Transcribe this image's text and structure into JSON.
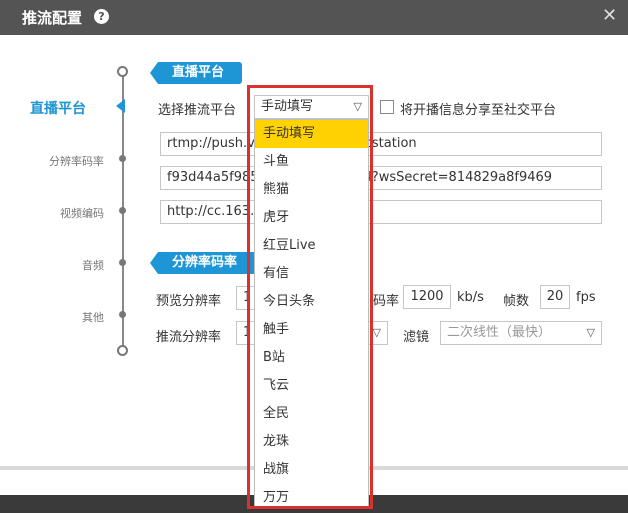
{
  "window": {
    "title": "推流配置"
  },
  "nav": {
    "active": "直播平台",
    "items": [
      "分辨率码率",
      "视频编码",
      "音频",
      "其他"
    ]
  },
  "sections": {
    "platform": "直播平台",
    "resolution": "分辨率码率"
  },
  "platform": {
    "select_label": "选择推流平台",
    "selected": "手动填写",
    "share_label": "将开播信息分享至社交平台",
    "url1": "rtmp://push.v.cc.163.com/live/cstation",
    "key": "f93d44a5f985c2e8b4c4436844?wsSecret=814829a8f9469",
    "url2": "http://cc.163.com"
  },
  "resolution": {
    "preview_label": "预览分辨率",
    "preview_value": "1",
    "bitrate_label": "码率",
    "bitrate_value": "1200",
    "bitrate_unit": "kb/s",
    "fps_label": "帧数",
    "fps_value": "20",
    "fps_unit": "fps",
    "push_label": "推流分辨率",
    "push_value": "1",
    "filter_label": "滤镜",
    "filter_value": "二次线性（最快）"
  },
  "dropdown": {
    "options": [
      "手动填写",
      "斗鱼",
      "熊猫",
      "虎牙",
      "红豆Live",
      "有信",
      "今日头条",
      "触手",
      "B站",
      "飞云",
      "全民",
      "龙珠",
      "战旗",
      "万万"
    ],
    "selected_index": 0
  },
  "colors": {
    "accent": "#1e95d4",
    "highlight": "#ffd200",
    "annotation": "#d8312e"
  }
}
